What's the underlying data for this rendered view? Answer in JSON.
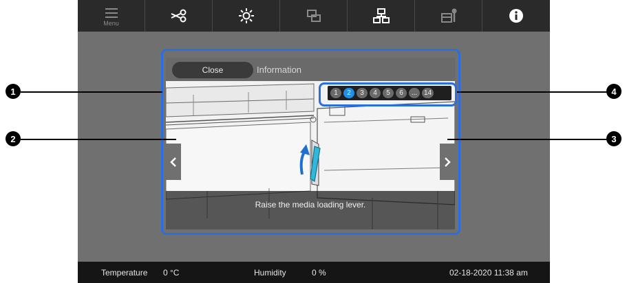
{
  "toolbar": {
    "tabs": [
      {
        "icon": "menu-icon",
        "label": "Menu"
      },
      {
        "icon": "scissors-icon",
        "label": ""
      },
      {
        "icon": "light-icon",
        "label": ""
      },
      {
        "icon": "layers-icon",
        "label": ""
      },
      {
        "icon": "network-icon",
        "label": ""
      },
      {
        "icon": "maintenance-icon",
        "label": ""
      },
      {
        "icon": "info-icon",
        "label": ""
      }
    ]
  },
  "dialog": {
    "close_label": "Close",
    "title": "Information",
    "caption": "Raise the media loading lever.",
    "pages": [
      "1",
      "2",
      "3",
      "4",
      "5",
      "6",
      "...",
      "14"
    ],
    "current_page": "2"
  },
  "status": {
    "temperature_label": "Temperature",
    "temperature_value": "0 °C",
    "humidity_label": "Humidity",
    "humidity_value": "0 %",
    "datetime": "02-18-2020 11:38 am"
  },
  "callouts": [
    "1",
    "2",
    "3",
    "4"
  ],
  "colors": {
    "accent": "#1e90e8",
    "callout": "#2a6ee0",
    "lever": "#2fb8d8"
  }
}
